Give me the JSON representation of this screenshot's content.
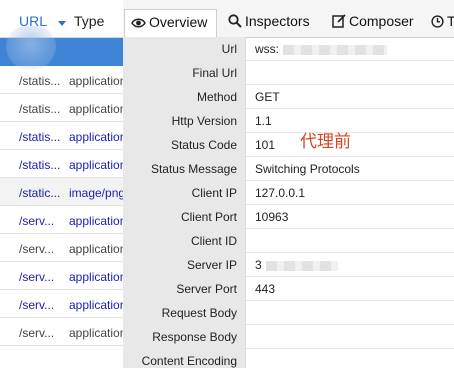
{
  "session_list": {
    "columns": {
      "url": "URL",
      "type": "Type"
    },
    "rows": [
      {
        "url": "",
        "type": "",
        "style": "selected"
      },
      {
        "url": "/statis...",
        "type": "application",
        "style": "dark"
      },
      {
        "url": "/statis...",
        "type": "application",
        "style": "dark"
      },
      {
        "url": "/statis...",
        "type": "application",
        "style": "link"
      },
      {
        "url": "/statis...",
        "type": "application",
        "style": "link"
      },
      {
        "url": "/static...",
        "type": "image/png",
        "style": "link gray"
      },
      {
        "url": "/serv...",
        "type": "application",
        "style": "link"
      },
      {
        "url": "/serv...",
        "type": "application",
        "style": "dark"
      },
      {
        "url": "/serv...",
        "type": "application",
        "style": "link"
      },
      {
        "url": "/serv...",
        "type": "application",
        "style": "link"
      },
      {
        "url": "/serv...",
        "type": "application",
        "style": "dark"
      }
    ]
  },
  "tabs": [
    {
      "label": "Overview",
      "icon": "eye-icon",
      "active": true
    },
    {
      "label": "Inspectors",
      "icon": "search-icon",
      "active": false
    },
    {
      "label": "Composer",
      "icon": "edit-icon",
      "active": false
    },
    {
      "label": "T",
      "icon": "clock-icon",
      "active": false
    }
  ],
  "properties": [
    {
      "key": "Url",
      "value": "wss:",
      "masked": true
    },
    {
      "key": "Final Url",
      "value": ""
    },
    {
      "key": "Method",
      "value": "GET"
    },
    {
      "key": "Http Version",
      "value": "1.1"
    },
    {
      "key": "Status Code",
      "value": "101"
    },
    {
      "key": "Status Message",
      "value": "Switching Protocols"
    },
    {
      "key": "Client IP",
      "value": "127.0.0.1"
    },
    {
      "key": "Client Port",
      "value": "10963"
    },
    {
      "key": "Client ID",
      "value": ""
    },
    {
      "key": "Server IP",
      "value": "3",
      "masked": true
    },
    {
      "key": "Server Port",
      "value": "443"
    },
    {
      "key": "Request Body",
      "value": ""
    },
    {
      "key": "Response Body",
      "value": ""
    },
    {
      "key": "Content Encoding",
      "value": ""
    }
  ],
  "annotation": "代理前"
}
